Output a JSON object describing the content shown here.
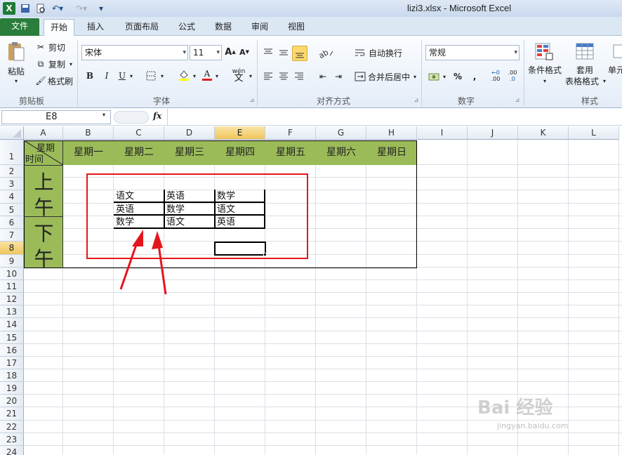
{
  "window": {
    "title": "lizi3.xlsx  -  Microsoft Excel"
  },
  "tabs": [
    "文件",
    "开始",
    "插入",
    "页面布局",
    "公式",
    "数据",
    "审阅",
    "视图"
  ],
  "ribbon": {
    "clipboard": {
      "paste": "粘贴",
      "cut": "剪切",
      "copy": "复制",
      "format_painter": "格式刷",
      "label": "剪贴板"
    },
    "font": {
      "name": "宋体",
      "size": "11",
      "label": "字体",
      "bold": "B",
      "italic": "I",
      "underline": "U",
      "font_color_glyph": "A",
      "phonetic": "wén"
    },
    "alignment": {
      "wrap": "自动换行",
      "merge": "合并后居中",
      "label": "对齐方式"
    },
    "number": {
      "format": "常规",
      "label": "数字",
      "percent": "%",
      "comma": ",",
      "inc": ".00",
      "dec": ".0"
    },
    "styles": {
      "conditional": "条件格式",
      "table_line1": "套用",
      "table_line2": "表格格式",
      "cell": "单元",
      "label": "样式"
    }
  },
  "formula_bar": {
    "cell_ref": "E8",
    "fx": "fx",
    "value": ""
  },
  "columns": [
    "A",
    "B",
    "C",
    "D",
    "E",
    "F",
    "G",
    "H",
    "I",
    "J",
    "K",
    "L"
  ],
  "rows": [
    "1",
    "2",
    "3",
    "4",
    "5",
    "6",
    "7",
    "8",
    "9",
    "10",
    "11",
    "12",
    "13",
    "14",
    "15",
    "16",
    "17",
    "18",
    "19",
    "20",
    "21",
    "22",
    "23",
    "24"
  ],
  "sheet": {
    "a1_top": "星期",
    "a1_bottom": "时间",
    "days": [
      "星期一",
      "星期二",
      "星期三",
      "星期四",
      "星期五",
      "星期六",
      "星期日"
    ],
    "morning": [
      "上",
      "午"
    ],
    "afternoon": [
      "下",
      "午"
    ],
    "inner_table": [
      [
        "语文",
        "英语",
        "数学"
      ],
      [
        "英语",
        "数学",
        "语文"
      ],
      [
        "数学",
        "语文",
        "英语"
      ]
    ]
  },
  "colors": {
    "header_green": "#9bbb59",
    "annotation_red": "#e4161d",
    "file_tab": "#2a7d3a"
  },
  "watermark": {
    "line1": "Bai 经验",
    "line2": "jingyan.baidu.com"
  }
}
